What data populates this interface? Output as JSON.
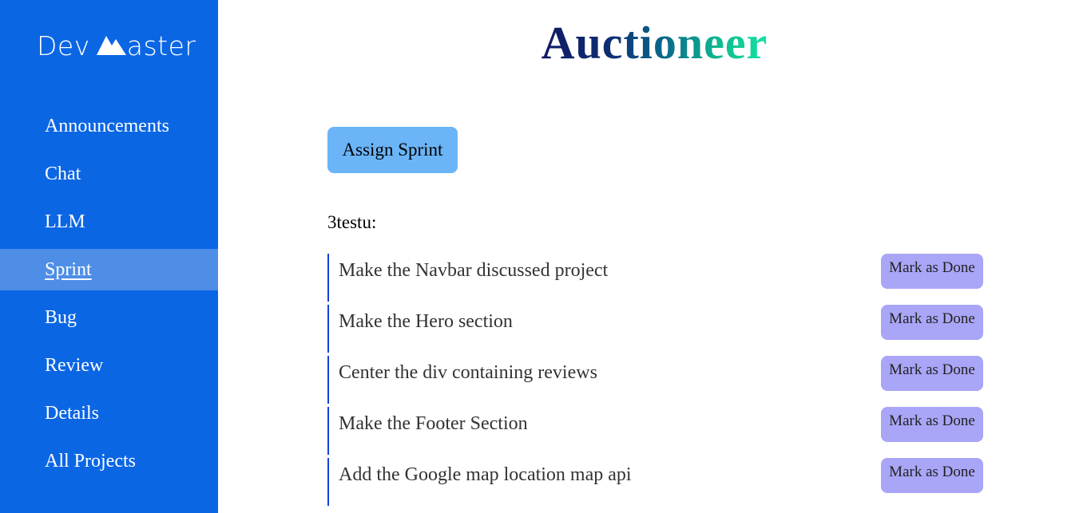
{
  "brand": {
    "name_left": "Dev",
    "name_right": "aster",
    "logo_icon": "mountain-icon"
  },
  "sidebar": {
    "items": [
      {
        "label": "Announcements",
        "active": false
      },
      {
        "label": "Chat",
        "active": false
      },
      {
        "label": "LLM",
        "active": false
      },
      {
        "label": "Sprint",
        "active": true
      },
      {
        "label": "Bug",
        "active": false
      },
      {
        "label": "Review",
        "active": false
      },
      {
        "label": "Details",
        "active": false
      },
      {
        "label": "All Projects",
        "active": false
      }
    ]
  },
  "main": {
    "project_title": "Auctioneer",
    "assign_button_label": "Assign Sprint",
    "sprint_name": "3testu:",
    "tasks": [
      {
        "text": "Make the Navbar discussed project",
        "button_label": "Mark as Done"
      },
      {
        "text": "Make the Hero section",
        "button_label": "Mark as Done"
      },
      {
        "text": "Center the div containing reviews",
        "button_label": "Mark as Done"
      },
      {
        "text": "Make the Footer Section",
        "button_label": "Mark as Done"
      },
      {
        "text": "Add the Google map location map api",
        "button_label": "Mark as Done"
      }
    ]
  },
  "colors": {
    "sidebar_bg": "#0b66e4",
    "sidebar_active_bg": "#4e8ee6",
    "assign_button_bg": "#6ab4f7",
    "done_button_bg": "#a9a5f7",
    "task_border": "#1a3fd8",
    "title_gradient_start": "#0f1a63",
    "title_gradient_end": "#14e3a5"
  }
}
